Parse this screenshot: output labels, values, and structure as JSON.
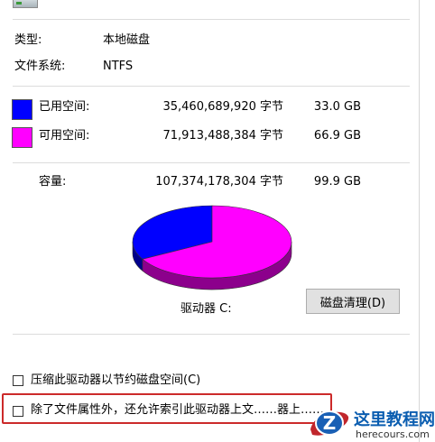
{
  "info": {
    "type_label": "类型:",
    "type_value": "本地磁盘",
    "fs_label": "文件系统:",
    "fs_value": "NTFS"
  },
  "space": {
    "used": {
      "label": "已用空间:",
      "bytes": "35,460,689,920 字节",
      "size": "33.0 GB",
      "color": "#0000ff"
    },
    "free": {
      "label": "可用空间:",
      "bytes": "71,913,488,384 字节",
      "size": "66.9 GB",
      "color": "#ff00ff"
    },
    "capacity": {
      "label": "容量:",
      "bytes": "107,374,178,304 字节",
      "size": "99.9 GB"
    }
  },
  "chart_data": {
    "type": "pie",
    "categories": [
      "已用空间",
      "可用空间"
    ],
    "values": [
      35460689920,
      71913488384
    ],
    "colors": [
      "#0000ff",
      "#ff00ff"
    ]
  },
  "drive": {
    "label": "驱动器 C:",
    "cleanup_button": "磁盘清理(D)"
  },
  "options": {
    "compress": "压缩此驱动器以节约磁盘空间(C)",
    "index": "除了文件属性外，还允许索引此驱动器上文……器上……"
  },
  "watermark": {
    "badge_letter": "Z",
    "title": "这里教程网",
    "url": "herecours.com"
  }
}
